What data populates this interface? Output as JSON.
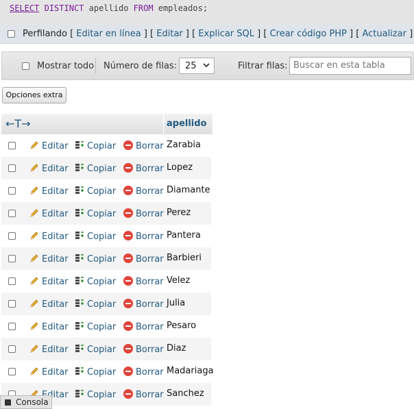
{
  "query": {
    "kw_select": "SELECT",
    "kw_distinct": "DISTINCT",
    "column": "apellido",
    "kw_from": "FROM",
    "table": "empleados;"
  },
  "profile": {
    "label": "Perfilando",
    "links": [
      "Editar en línea",
      "Editar",
      "Explicar SQL",
      "Crear código PHP",
      "Actualizar"
    ]
  },
  "nav": {
    "show_all": "Mostrar todo",
    "rows_label": "Número de filas:",
    "rows_value": "25",
    "filter_label": "Filtrar filas:",
    "filter_placeholder": "Buscar en esta tabla"
  },
  "extra_options": "Opciones extra",
  "table": {
    "column_header": "apellido",
    "sort_arrows": "←T→",
    "actions": {
      "edit": "Editar",
      "copy": "Copiar",
      "delete": "Borrar"
    },
    "rows": [
      "Zarabia",
      "Lopez",
      "Diamante",
      "Perez",
      "Pantera",
      "Barbieri",
      "Velez",
      "Julia",
      "Pesaro",
      "Diaz",
      "Madariaga",
      "Sanchez"
    ]
  },
  "console": "Consola",
  "colors": {
    "link": "#235a81",
    "keyword": "#7a1a9a",
    "delete_icon": "#e0453a",
    "edit_icon": "#e8a317"
  }
}
